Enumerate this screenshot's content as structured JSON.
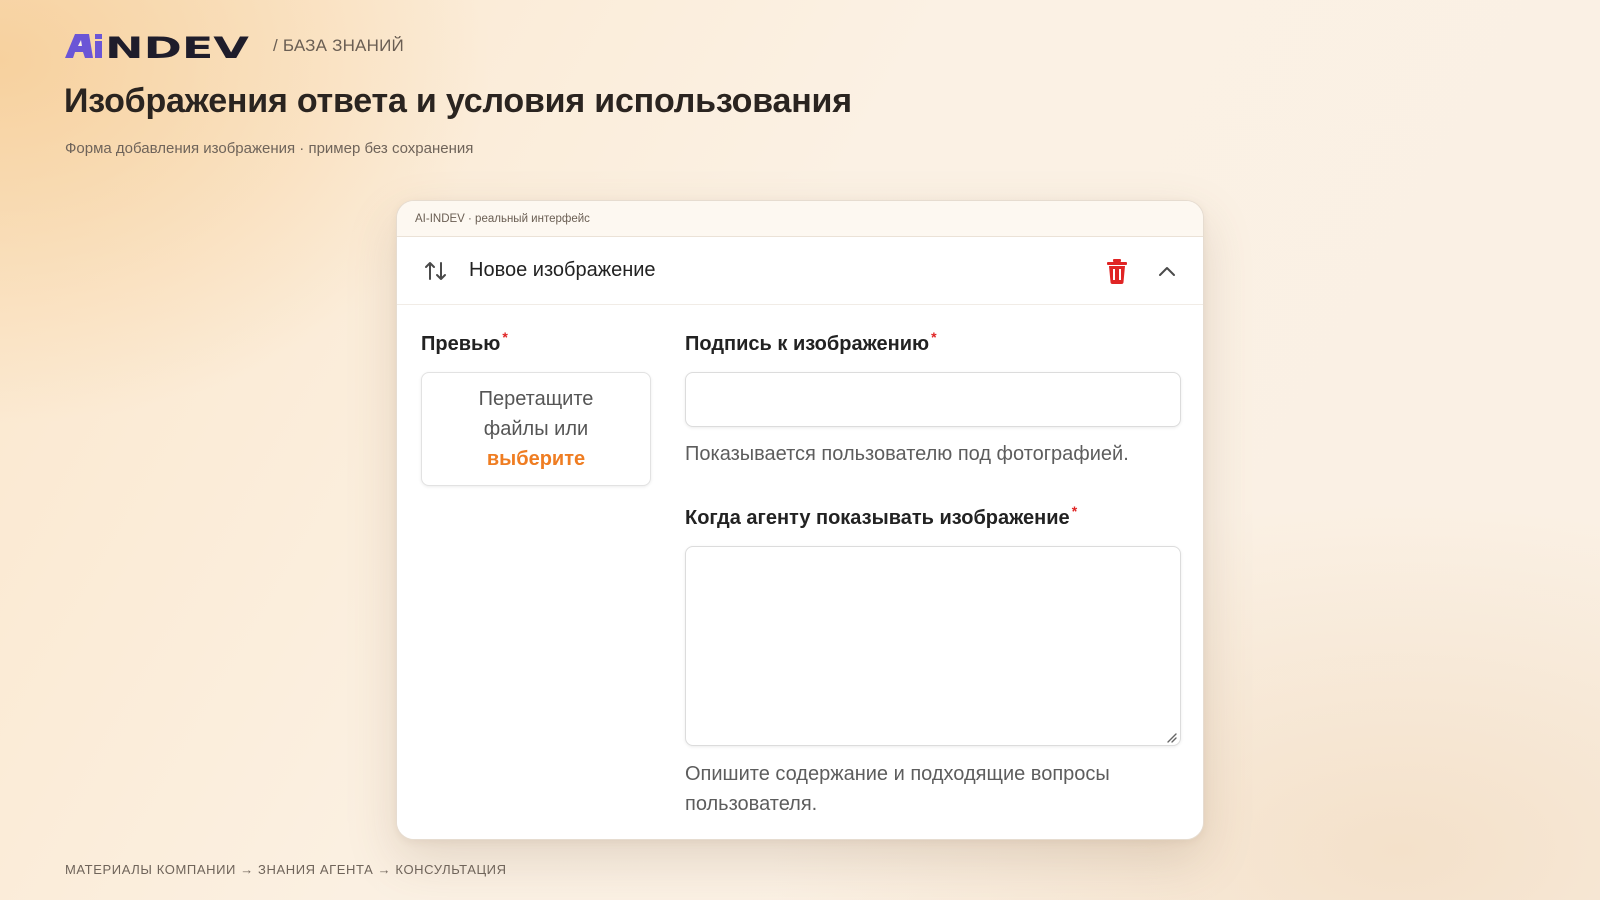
{
  "brand": {
    "logo_text": "AiNDEV",
    "breadcrumb": "/ БАЗА ЗНАНИЙ"
  },
  "page": {
    "title": "Изображения ответа и условия использования",
    "subtitle": "Форма добавления изображения · пример без сохранения",
    "footer": "МАТЕРИАЛЫ КОМПАНИИ → ЗНАНИЯ АГЕНТА → КОНСУЛЬТАЦИЯ"
  },
  "window": {
    "caption": "AI-INDEV · реальный интерфейс"
  },
  "card": {
    "title": "Новое изображение",
    "icons": {
      "sort": "swap-vertical-icon",
      "delete": "trash-icon",
      "collapse": "chevron-up-icon"
    }
  },
  "form": {
    "required_mark": "*",
    "preview": {
      "label": "Превью",
      "drop_line1": "Перетащите",
      "drop_line2": "файлы или",
      "drop_link": "выберите"
    },
    "caption": {
      "label": "Подпись к изображению",
      "value": "",
      "hint": "Показывается пользователю под фотографией."
    },
    "when": {
      "label": "Когда агенту показывать изображение",
      "value": "",
      "hint_line1": "Опишите содержание и подходящие вопросы",
      "hint_line2": "пользователя."
    }
  },
  "colors": {
    "accent_orange": "#ef7d22",
    "danger_red": "#e02424",
    "logo_purple": "#6b55d6",
    "logo_dark": "#1f1d2b"
  }
}
